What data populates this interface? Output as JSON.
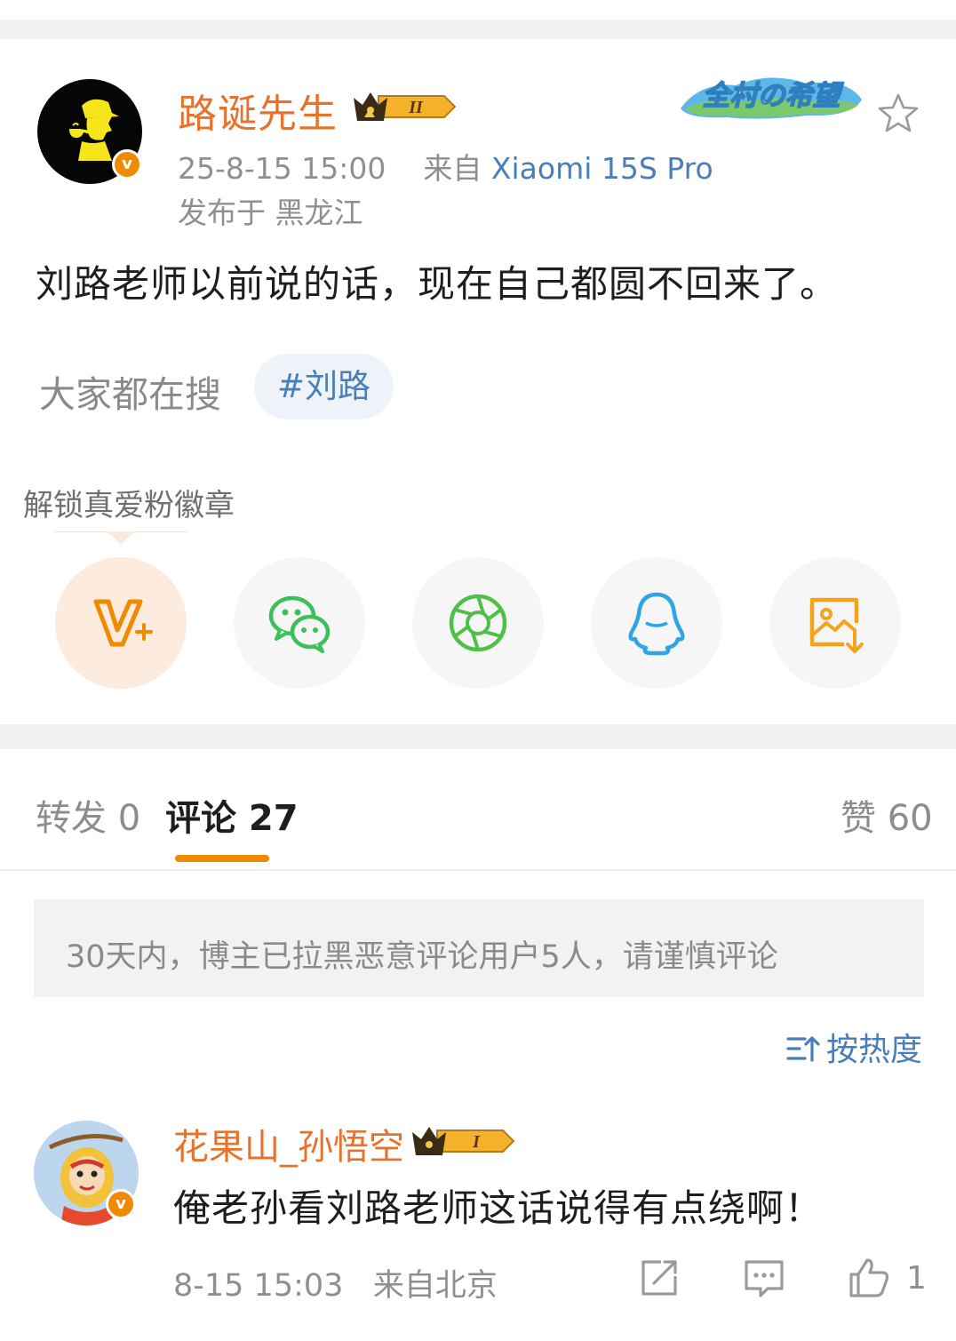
{
  "post": {
    "author": "路诞先生",
    "member_level": "II",
    "avatar_icon": "detective-silhouette-avatar",
    "village_badge": "全村の希望",
    "date": "25-8-15 15:00",
    "source_prefix": "来自",
    "device": "Xiaomi 15S Pro",
    "location": "发布于 黑龙江",
    "text": "刘路老师以前说的话，现在自己都圆不回来了。",
    "search_label": "大家都在搜",
    "topic": "#刘路"
  },
  "share": {
    "tip": "解锁真爱粉徽章",
    "buttons": [
      {
        "name": "fan-badge",
        "icon": "v-plus-icon"
      },
      {
        "name": "wechat",
        "icon": "wechat-icon"
      },
      {
        "name": "moments",
        "icon": "aperture-icon"
      },
      {
        "name": "qq",
        "icon": "qq-penguin-icon"
      },
      {
        "name": "save-image",
        "icon": "image-download-icon"
      }
    ]
  },
  "tabs": {
    "repost": "转发 0",
    "comments": "评论 27",
    "likes": "赞 60"
  },
  "notice": "30天内，博主已拉黑恶意评论用户5人，请谨慎评论",
  "sort_label": "按热度",
  "comments": [
    {
      "name": "花果山_孙悟空",
      "member_level": "I",
      "text": "俺老孙看刘路老师这话说得有点绕啊！",
      "date": "8-15 15:03",
      "source": "来自北京",
      "likes": "1"
    }
  ],
  "colors": {
    "accent": "#f08a00",
    "username": "#e8722a",
    "link": "#4a7eb8",
    "band": "#f1f1f1"
  }
}
